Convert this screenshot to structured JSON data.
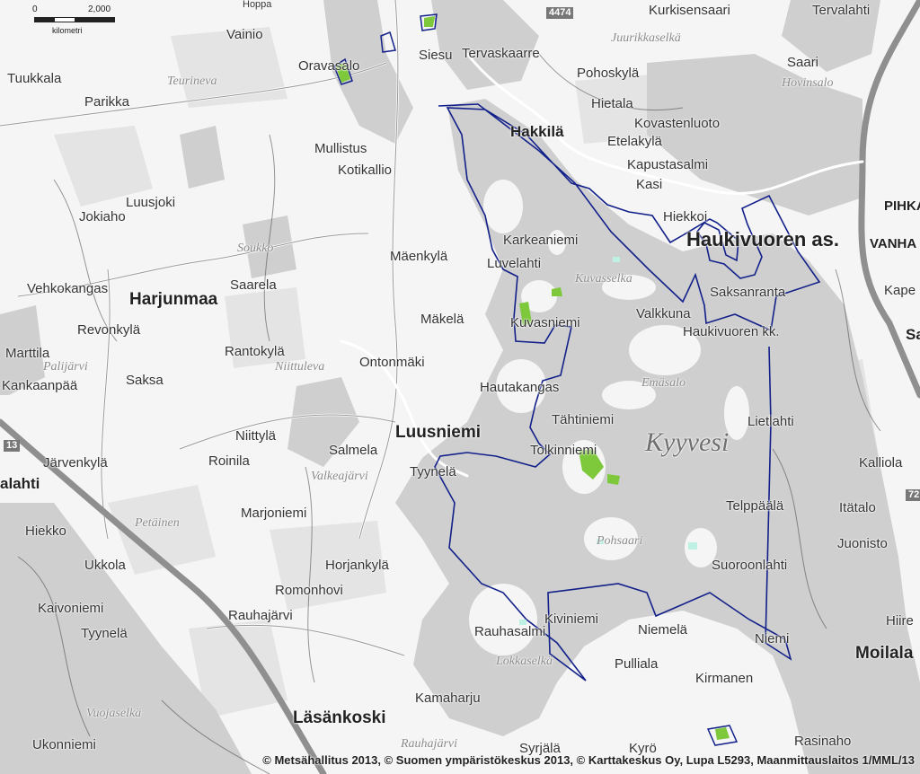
{
  "scale": {
    "start": "0",
    "end": "2,000",
    "unit": "kilometri"
  },
  "copyright": "© Metsähallitus 2013, © Suomen ympäristökeskus 2013, © Karttakeskus Oy, Lupa L5293, Maanmittauslaitos 1/MML/13",
  "roads": {
    "r13": "13",
    "r4474": "4474",
    "r72": "72"
  },
  "places": {
    "vainio": "Vainio",
    "oravasalo": "Oravasalo",
    "siesu": "Siesu",
    "tervaskaarre": "Tervaskaarre",
    "kurkisensaari": "Kurkisensaari",
    "tervalahti": "Tervalahti",
    "tuukkala": "Tuukkala",
    "parikka": "Parikka",
    "pohoskyla": "Pohoskylä",
    "hietala": "Hietala",
    "saari": "Saari",
    "kovastenluoto": "Kovastenluoto",
    "hakkila": "Hakkilä",
    "etelakyla": "Etelakylä",
    "mullistus": "Mullistus",
    "kotikallio": "Kotikallio",
    "kapustasalmi": "Kapustasalmi",
    "kasi": "Kasi",
    "luusjoki": "Luusjoki",
    "jokiaho": "Jokiaho",
    "hiekkoi": "Hiekkoi",
    "pihka": "PIHKA",
    "haukivuoren_as": "Haukivuoren as.",
    "vanha": "VANHA",
    "karkeaniemi": "Karkeaniemi",
    "luvelahti": "Luvelahti",
    "maenkyla": "Mäenkylä",
    "vehkokangas": "Vehkokangas",
    "saarela": "Saarela",
    "harjunmaa": "Harjunmaa",
    "saksanranta": "Saksanranta",
    "kape": "Kape",
    "kuvasniemi": "Kuvasniemi",
    "makela": "Mäkelä",
    "valkkuna": "Valkkuna",
    "haukivuoren_kk": "Haukivuoren kk.",
    "revonkyla": "Revonkylä",
    "marttila": "Marttila",
    "rantokyla": "Rantokylä",
    "ontonmaki": "Ontonmäki",
    "kankaanpaa": "Kankaanpää",
    "saksa": "Saksa",
    "hautakangas": "Hautakangas",
    "tahtiniemi": "Tähtiniemi",
    "luusniemi": "Luusniemi",
    "lietlahti": "Lietlahti",
    "niittyla": "Niittylä",
    "salmela": "Salmela",
    "roinila": "Roinila",
    "kalliola": "Kalliola",
    "tolkinniemi": "Tolkinniemi",
    "jarvenkyla": "Järvenkylä",
    "tyynela1": "Tyynelä",
    "ahti": "alahti",
    "itatalo": "Itätalo",
    "telppaala": "Telppäälä",
    "marjoniemi": "Marjoniemi",
    "hiekko": "Hiekko",
    "juonisto": "Juonisto",
    "ukkola": "Ukkola",
    "horjankyla": "Horjankylä",
    "suoroonlahti": "Suoroonlahti",
    "romonhovi": "Romonhovi",
    "kaivoniemi": "Kaivoniemi",
    "rauhajarvi": "Rauhajärvi",
    "kiviniemi": "Kiviniemi",
    "niemela": "Niemelä",
    "hiire": "Hiire",
    "tyynela2": "Tyynelä",
    "rauhasalmi": "Rauhasalmi",
    "niemi": "Niemi",
    "moilala": "Moilala",
    "pulliala": "Pulliala",
    "kirmanen": "Kirmanen",
    "kamaharju": "Kamaharju",
    "lasankoski": "Läsänkoski",
    "ukonniemi": "Ukonniemi",
    "syrjala": "Syrjälä",
    "kyro": "Kyrö",
    "rasinaho": "Rasinaho",
    "sa": "Sa",
    "hoppa": "Hoppa"
  },
  "waters": {
    "kyyvesi": "Kyyvesi",
    "juurikkaselka": "Juurikkaselkä",
    "hovinsalo": "Hovinsalo",
    "teurineva": "Teurineva",
    "soukko": "Soukko",
    "kuvasselka": "Kuvasselka",
    "palijarvi": "Palijärvi",
    "niittuleva": "Niittuleva",
    "emasalo": "Emäsalo",
    "valkeajarvi": "Valkeajärvi",
    "petainen": "Petäinen",
    "pohsaari": "Pohsaari",
    "lokkaselka": "Lokkaselkä",
    "vuojaselka": "Vuojaselkä",
    "rauhajarvi2": "Rauhajärvi"
  }
}
